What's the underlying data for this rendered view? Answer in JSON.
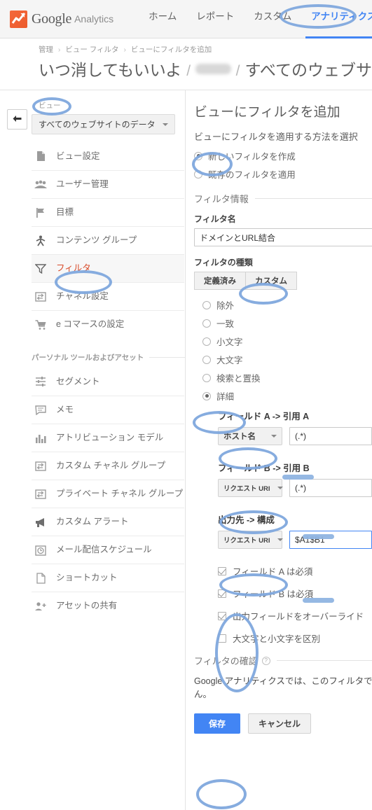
{
  "brand": {
    "google": "Google",
    "analytics": "Analytics",
    "logo_icon": "analytics-logo-icon"
  },
  "topnav": {
    "items": [
      {
        "label": "ホーム",
        "active": false
      },
      {
        "label": "レポート",
        "active": false
      },
      {
        "label": "カスタム",
        "active": false
      },
      {
        "label": "アナリティクス設定",
        "active": true
      }
    ]
  },
  "breadcrumb": {
    "items": [
      "管理",
      "ビュー フィルタ",
      "ビューにフィルタを追加"
    ],
    "separator": "›"
  },
  "account_title": {
    "account": "いつ消してもいいよ",
    "property_redacted": true,
    "view": "すべてのウェブサ"
  },
  "sidebar": {
    "view_label": "ビュー",
    "view_selected": "すべてのウェブサイトのデータ",
    "back_button": "back-arrow",
    "items": [
      {
        "label": "ビュー設定",
        "icon": "document-icon",
        "active": false
      },
      {
        "label": "ユーザー管理",
        "icon": "users-icon",
        "active": false
      },
      {
        "label": "目標",
        "icon": "flag-icon",
        "active": false
      },
      {
        "label": "コンテンツ グループ",
        "icon": "person-group-icon",
        "active": false
      },
      {
        "label": "フィルタ",
        "icon": "filter-icon",
        "active": true
      },
      {
        "label": "チャネル設定",
        "icon": "channel-icon",
        "active": false
      },
      {
        "label": "e コマースの設定",
        "icon": "cart-icon",
        "active": false
      }
    ],
    "section_header": "パーソナル ツールおよびアセット",
    "personal_items": [
      {
        "label": "セグメント",
        "icon": "segment-icon"
      },
      {
        "label": "メモ",
        "icon": "comment-icon"
      },
      {
        "label": "アトリビューション モデル",
        "icon": "bar-chart-icon"
      },
      {
        "label": "カスタム チャネル グループ",
        "icon": "channel-icon"
      },
      {
        "label": "プライベート チャネル グループ",
        "icon": "channel-icon"
      },
      {
        "label": "カスタム アラート",
        "icon": "megaphone-icon"
      },
      {
        "label": "メール配信スケジュール",
        "icon": "clock-icon"
      },
      {
        "label": "ショートカット",
        "icon": "page-icon"
      },
      {
        "label": "アセットの共有",
        "icon": "add-person-icon"
      }
    ]
  },
  "main": {
    "title": "ビューにフィルタを追加",
    "method_label": "ビューにフィルタを適用する方法を選択",
    "method_options": [
      {
        "label": "新しいフィルタを作成",
        "selected": true
      },
      {
        "label": "既存のフィルタを適用",
        "selected": false
      }
    ],
    "filter_info_header": "フィルタ情報",
    "filter_name_label": "フィルタ名",
    "filter_name_value": "ドメインとURL結合",
    "filter_type_label": "フィルタの種類",
    "type_tabs": [
      {
        "label": "定義済み",
        "active": false
      },
      {
        "label": "カスタム",
        "active": true
      }
    ],
    "custom_options": [
      {
        "label": "除外",
        "selected": false
      },
      {
        "label": "一致",
        "selected": false
      },
      {
        "label": "小文字",
        "selected": false
      },
      {
        "label": "大文字",
        "selected": false
      },
      {
        "label": "検索と置換",
        "selected": false
      },
      {
        "label": "詳細",
        "selected": true
      }
    ],
    "advanced": {
      "field_a_title": "フィールド A -> 引用 A",
      "field_a_select": "ホスト名",
      "field_a_value": "(.*)",
      "field_b_title": "フィールド B -> 引用 B",
      "field_b_select": "リクエスト URI",
      "field_b_value": "(.*)",
      "output_title": "出力先 -> 構成",
      "output_select": "リクエスト URI",
      "output_value": "$A1$B1"
    },
    "checkboxes": [
      {
        "label": "フィールド A は必須",
        "checked": true
      },
      {
        "label": "フィールド B は必須",
        "checked": true
      },
      {
        "label": "出力フィールドをオーバーライド",
        "checked": true
      },
      {
        "label": "大文字と小文字を区別",
        "checked": false
      }
    ],
    "verify_header": "フィルタの確認",
    "verify_help": "?",
    "verify_text": "Google アナリティクスでは、このフィルタでこせん。",
    "save_label": "保存",
    "cancel_label": "キャンセル"
  },
  "colors": {
    "accent_blue": "#4285f4",
    "annotation_blue": "#7fa8dd",
    "active_nav_red": "#d84b2a",
    "logo_orange": "#ec5b2c"
  }
}
